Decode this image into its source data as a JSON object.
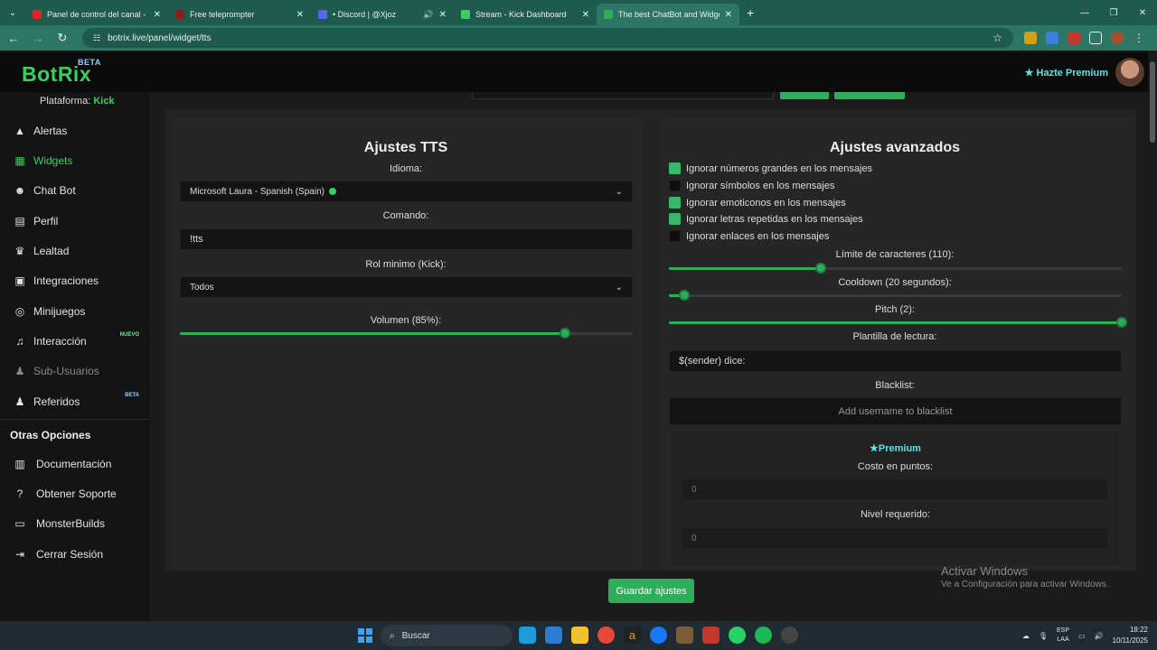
{
  "browser": {
    "tabs": [
      {
        "title": "Panel de control del canal - You",
        "color": "#e02424",
        "active": false
      },
      {
        "title": "Free teleprompter",
        "color": "#8b1d1d",
        "active": false
      },
      {
        "title": "• Discord | @Xjoz",
        "color": "#5865f2",
        "active": false,
        "sound": true
      },
      {
        "title": "Stream - Kick Dashboard",
        "color": "#37d060",
        "active": false
      },
      {
        "title": "The best ChatBot and Widgets",
        "color": "#2fae5a",
        "active": true
      }
    ],
    "url": "botrix.live/panel/widget/tts"
  },
  "header": {
    "logo": "BotRix",
    "logo_badge": "BETA",
    "premium_link": "Hazte Premium"
  },
  "sidebar": {
    "platform_label": "Plataforma:",
    "platform_value": "Kick",
    "items": [
      {
        "label": "Alertas",
        "icon": "warning-icon"
      },
      {
        "label": "Widgets",
        "icon": "grid-icon",
        "active": true
      },
      {
        "label": "Chat Bot",
        "icon": "robot-icon"
      },
      {
        "label": "Perfil",
        "icon": "id-card-icon"
      },
      {
        "label": "Lealtad",
        "icon": "trophy-icon"
      },
      {
        "label": "Integraciones",
        "icon": "plug-icon"
      },
      {
        "label": "Minijuegos",
        "icon": "gamepad-icon"
      },
      {
        "label": "Interacción",
        "icon": "music-icon",
        "badge": "NUEVO"
      },
      {
        "label": "Sub-Usuarios",
        "icon": "users-icon",
        "dim": true
      },
      {
        "label": "Referidos",
        "icon": "users-icon",
        "badge": "BETA"
      }
    ],
    "other_title": "Otras Opciones",
    "other_items": [
      {
        "label": "Documentación",
        "icon": "book-icon"
      },
      {
        "label": "Obtener Soporte",
        "icon": "help-icon"
      },
      {
        "label": "MonsterBuilds",
        "icon": "laptop-icon"
      },
      {
        "label": "Cerrar Sesión",
        "icon": "logout-icon"
      }
    ]
  },
  "tts": {
    "title": "Ajustes TTS",
    "language_label": "Idioma:",
    "language_value": "Microsoft Laura - Spanish (Spain)",
    "command_label": "Comando:",
    "command_value": "!tts",
    "role_label": "Rol minimo (Kick):",
    "role_value": "Todos",
    "volume_label": "Volumen (85%):",
    "volume_percent": 85
  },
  "advanced": {
    "title": "Ajustes avanzados",
    "checks": [
      {
        "label": "Ignorar números grandes en los mensajes",
        "checked": true
      },
      {
        "label": "Ignorar símbolos en los mensajes",
        "checked": false
      },
      {
        "label": "Ignorar emoticonos en los mensajes",
        "checked": true
      },
      {
        "label": "Ignorar letras repetidas en los mensajes",
        "checked": true
      },
      {
        "label": "Ignorar enlaces en los mensajes",
        "checked": false
      }
    ],
    "char_limit_label": "Límite de caracteres (110):",
    "char_limit_fraction": 0.335,
    "cooldown_label": "Cooldown (20 segundos):",
    "cooldown_fraction": 0.033,
    "pitch_label": "Pitch (2):",
    "pitch_fraction": 1.0,
    "template_label": "Plantilla de lectura:",
    "template_value": "$(sender) dice:",
    "blacklist_label": "Blacklist:",
    "blacklist_placeholder": "Add username to blacklist"
  },
  "premium": {
    "title": "Premium",
    "cost_label": "Costo en puntos:",
    "cost_value": "0",
    "level_label": "Nivel requerido:",
    "level_value": "0"
  },
  "save_label": "Guardar ajustes",
  "watermark": {
    "line1": "Activar Windows",
    "line2": "Ve a Configuración para activar Windows."
  },
  "taskbar": {
    "search_placeholder": "Buscar",
    "lang_top": "ESP",
    "lang_bottom": "LAA",
    "time": "18:22",
    "date": "10/11/2025"
  }
}
